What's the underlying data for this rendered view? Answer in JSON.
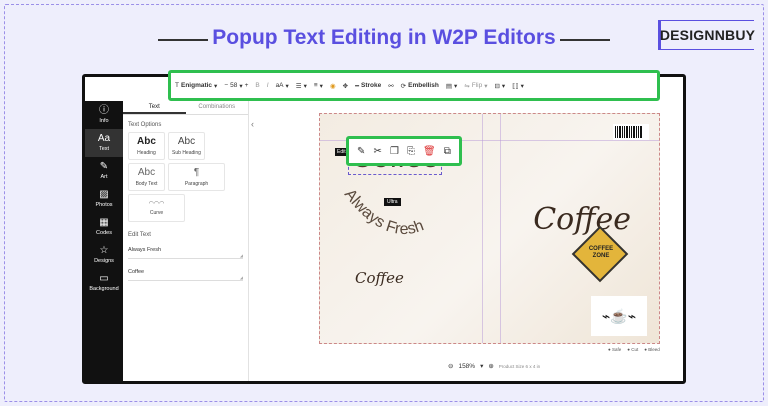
{
  "headline": "Popup Text Editing in W2P Editors",
  "brand": "DESIGNNBUY",
  "sidebar": {
    "items": [
      {
        "label": "Info",
        "icon": "info-icon",
        "glyph": "ⓘ"
      },
      {
        "label": "Text",
        "icon": "text-icon",
        "glyph": "Aa"
      },
      {
        "label": "Art",
        "icon": "art-icon",
        "glyph": "✎"
      },
      {
        "label": "Photos",
        "icon": "photos-icon",
        "glyph": "▨"
      },
      {
        "label": "Codes",
        "icon": "codes-icon",
        "glyph": "▦"
      },
      {
        "label": "Designs",
        "icon": "designs-icon",
        "glyph": "☆"
      },
      {
        "label": "Background",
        "icon": "background-icon",
        "glyph": "▭"
      }
    ]
  },
  "panel": {
    "tabs": [
      "Text",
      "Combinations"
    ],
    "text_options_title": "Text Options",
    "options": [
      {
        "big": "Abc",
        "label": "Heading"
      },
      {
        "big": "Abc",
        "label": "Sub Heading"
      },
      {
        "big": "Abc",
        "label": "Body Text"
      },
      {
        "big": "¶",
        "label": "Paragraph"
      },
      {
        "big": "◠◠◠",
        "label": "Curve"
      }
    ],
    "edit_text_title": "Edit Text",
    "fields": [
      "Always Fresh",
      "Coffee"
    ]
  },
  "toolbar": {
    "font": "Enigmatic",
    "size": "58",
    "case": "aA",
    "stroke": "Stroke",
    "embellish": "Embellish",
    "flip": "Flip"
  },
  "design": {
    "main_text": "Coffee",
    "arc_text": "Always Fresh",
    "script_text": "Coffee",
    "small_script": "Coffee",
    "zone_line1": "COFFEE",
    "zone_line2": "ZONE",
    "tag_side": "Edit",
    "tag_center": "Ultra"
  },
  "zoom": {
    "level": "158%",
    "product_size": "Product Size 6 x 4 in"
  },
  "legend": [
    "Safe",
    "Cut",
    "Bleed"
  ],
  "colors": {
    "accent": "#5a4fe0",
    "highlight": "#2fbf4f",
    "coffee": "#4e3b2c"
  }
}
